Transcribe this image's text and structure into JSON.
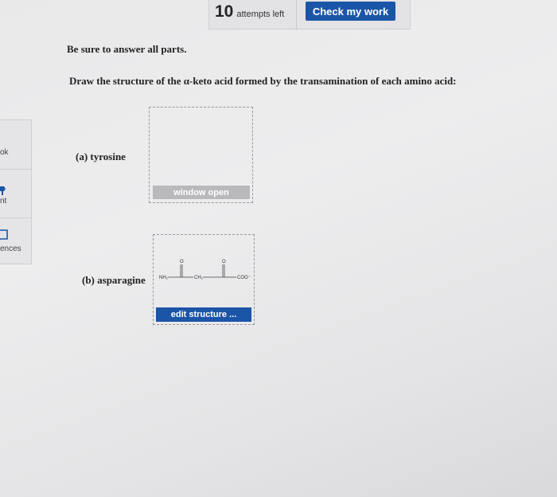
{
  "topbar": {
    "attempts_count": "10",
    "attempts_label": "attempts left",
    "check_button": "Check my work"
  },
  "left_panel": {
    "items": [
      {
        "label": "ok"
      },
      {
        "label": "nt"
      },
      {
        "label": "ences"
      }
    ]
  },
  "instructions": "Be sure to answer all parts.",
  "question": "Draw the structure of the α-keto acid formed by the transamination of each amino acid:",
  "parts": [
    {
      "label": "(a) tyrosine",
      "button": "window open"
    },
    {
      "label": "(b) asparagine",
      "button": "edit structure ..."
    }
  ],
  "structure_b": {
    "atoms": [
      "NH₂",
      "O",
      "CH₂",
      "O",
      "COO⁻"
    ]
  },
  "colors": {
    "primary_button": "#1b55a8",
    "disabled_button": "#b9b9bc"
  }
}
